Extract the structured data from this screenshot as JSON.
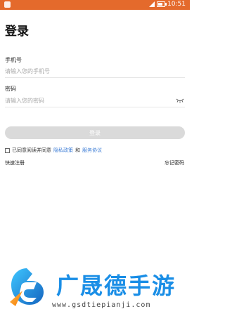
{
  "status_bar": {
    "time": "10:51"
  },
  "page": {
    "title": "登录"
  },
  "phone": {
    "label": "手机号",
    "placeholder": "请输入您的手机号"
  },
  "password": {
    "label": "密码",
    "placeholder": "请输入您的密码"
  },
  "login_button": "登录",
  "agreement": {
    "prefix": "已同意阅读并同意",
    "privacy": "隐私政策",
    "and": "和",
    "service": "服务协议"
  },
  "links": {
    "register": "快速注册",
    "forgot": "忘记密码"
  },
  "watermark": {
    "brand": "广晟德手游",
    "url": "www.gsdtiepianji.com"
  },
  "colors": {
    "status_bar": "#e46a2c",
    "button_disabled": "#dadada",
    "link": "#3a7bd5",
    "brand": "#1a8ee6"
  }
}
